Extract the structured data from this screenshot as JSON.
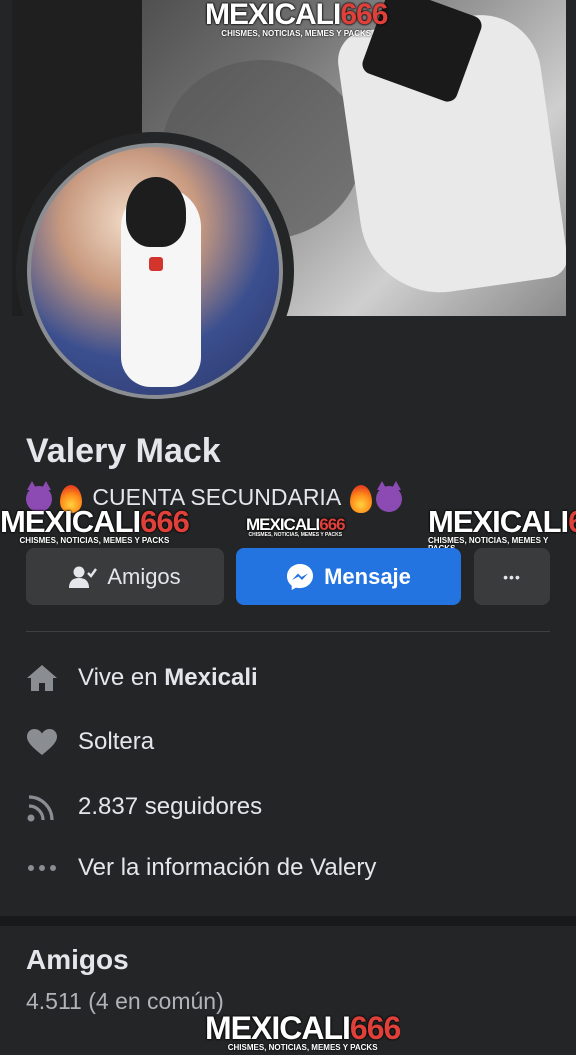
{
  "profile": {
    "name": "Valery Mack",
    "bio_text": "CUENTA SECUNDARIA",
    "emoji_left": [
      "devil-emoji",
      "fire-emoji"
    ],
    "emoji_right": [
      "fire-emoji",
      "devil-emoji"
    ]
  },
  "actions": {
    "friends_label": "Amigos",
    "message_label": "Mensaje",
    "more_label": "•••"
  },
  "info": {
    "lives_prefix": "Vive en",
    "lives_city": "Mexicali",
    "relationship": "Soltera",
    "followers": "2.837 seguidores",
    "see_info": "Ver la información de Valery"
  },
  "friends_section": {
    "title": "Amigos",
    "count": "4.511 (4 en común)"
  },
  "watermark": {
    "brand": "MEXICALI",
    "number": "666",
    "tagline": "CHISMES, NOTICIAS, MEMES Y PACKS"
  },
  "colors": {
    "background": "#242526",
    "primary_button": "#2374e1",
    "secondary_button": "#3a3b3c",
    "text": "#e4e6eb",
    "secondary_text": "#b0b3b8"
  }
}
